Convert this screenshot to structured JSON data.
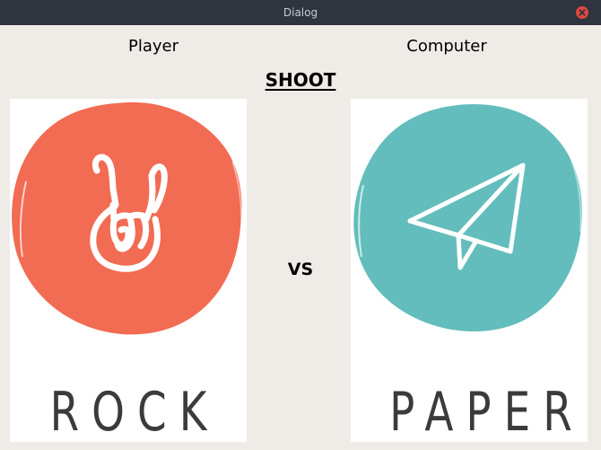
{
  "window": {
    "title": "Dialog",
    "titlebar_color": "#2f343f",
    "close_color": "#e0473f"
  },
  "labels": {
    "player": "Player",
    "computer": "Computer",
    "shoot": "SHOOT",
    "vs": "VS"
  },
  "player_choice": {
    "caption": "ROCK",
    "icon": "rock-hand-icon",
    "color": "#f26b53"
  },
  "computer_choice": {
    "caption": "PAPER",
    "icon": "paper-plane-icon",
    "color": "#63bdbc"
  }
}
